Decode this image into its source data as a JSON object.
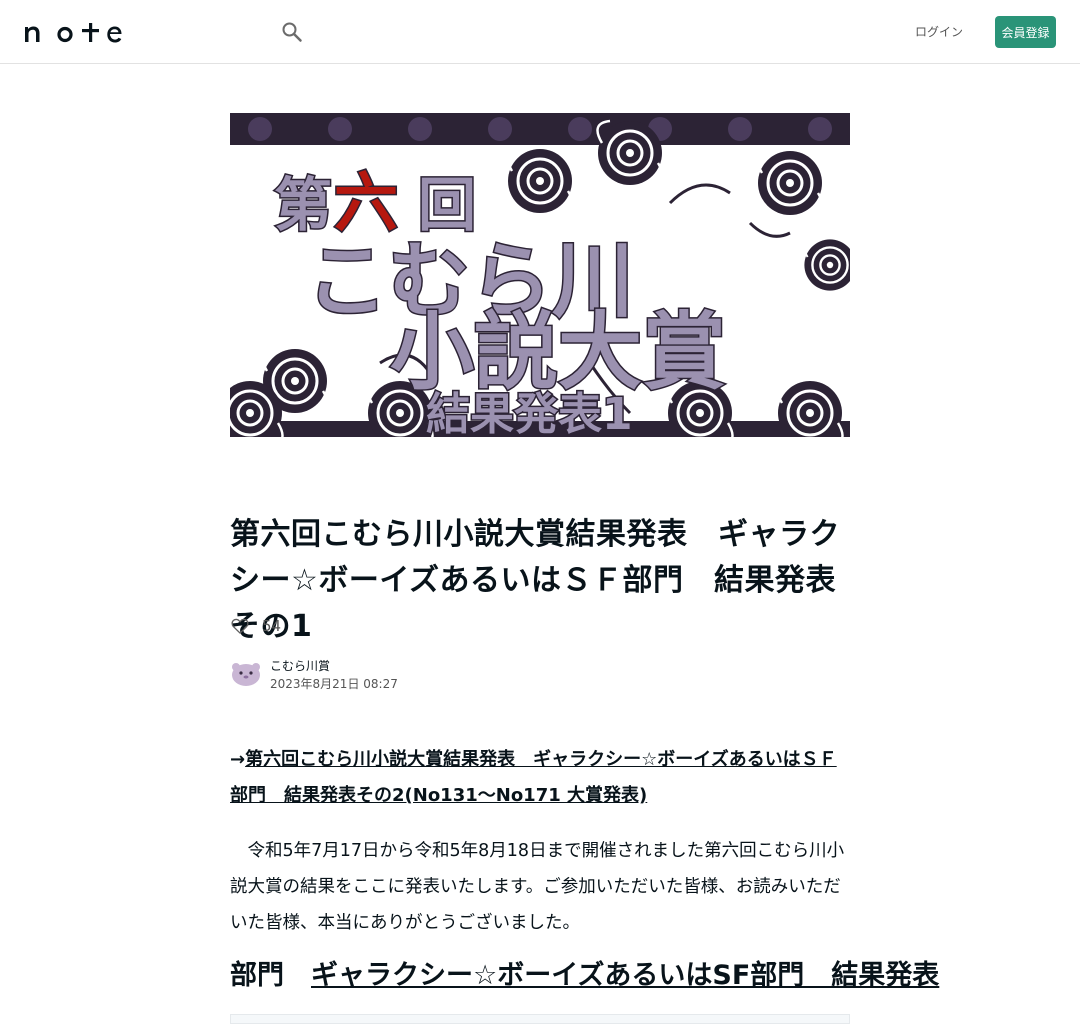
{
  "header": {
    "logo_alt": "note",
    "login_label": "ログイン",
    "signup_label": "会員登録"
  },
  "hero": {
    "text_line1_a": "第",
    "text_line1_b": "六",
    "text_line1_c": "回",
    "text_line2": "こむら川",
    "text_line3": "小説大賞",
    "text_line4": "結果発表1",
    "colors": {
      "dark": "#2c2335",
      "purple": "#9b91b0",
      "red": "#b6180f"
    }
  },
  "article": {
    "title": "第六回こむら川小説大賞結果発表　ギャラクシー☆ボーイズあるいはＳＦ部門　結果発表その1",
    "like_count": "54",
    "author_name": "こむら川賞",
    "date": "2023年8月21日 08:27",
    "para1_arrow": "→",
    "para1_link": "第六回こむら川小説大賞結果発表　ギャラクシー☆ボーイズあるいはＳＦ部門　結果発表その2(No131〜No171 大賞発表)",
    "para2": "　令和5年7月17日から令和5年8月18日まで開催されました第六回こむら川小説大賞の結果をここに発表いたします。ご参加いただいた皆様、お読みいただいた皆様、本当にありがとうございました。",
    "section_prefix": "部門　",
    "section_link": "ギャラクシー☆ボーイズあるいはSF部門　結果発表"
  },
  "colors": {
    "accent": "#2a9478",
    "text": "#08131a"
  }
}
